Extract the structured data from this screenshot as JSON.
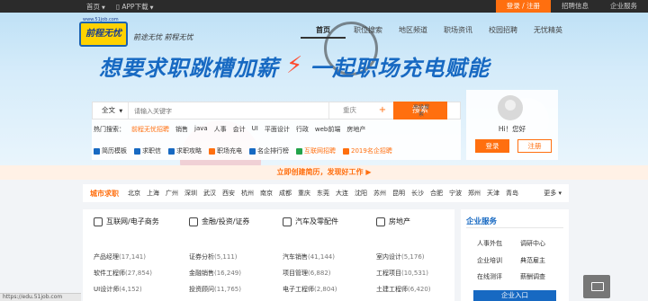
{
  "topbar": {
    "home": "首页",
    "app": "APP下载",
    "login_register": "登录 / 注册",
    "recruit_info": "招聘信息",
    "enterprise_service": "企业服务"
  },
  "logo": {
    "text": "前程无忧",
    "url": "www.51job.com"
  },
  "slogan": "前途无忧 前程无忧",
  "nav": [
    "首页",
    "职位搜索",
    "地区频道",
    "职场资讯",
    "校园招聘",
    "无忧精英"
  ],
  "banner": {
    "left": "想要求职跳槽加薪",
    "bolt": "⚡",
    "right": "一起职场充电赋能"
  },
  "search": {
    "type": "全文",
    "placeholder": "请输入关键字",
    "city": "重庆",
    "plus": "+",
    "button": "搜索",
    "advanced": "高级搜索"
  },
  "hot": {
    "label": "热门搜索：",
    "items": [
      "前程无忧招聘",
      "销售",
      "java",
      "人事",
      "会计",
      "UI",
      "平面设计",
      "行政",
      "web前端",
      "房地产"
    ]
  },
  "tools": [
    "简历模板",
    "求职信",
    "求职攻略",
    "职场充电",
    "名企排行榜",
    "互联网招聘",
    "2019名企招聘"
  ],
  "login": {
    "greeting": "Hi！您好",
    "login": "登录",
    "register": "注册"
  },
  "resume_strip": "立即创建简历，发现好工作 ▶",
  "city_row": {
    "title": "城市求职",
    "cities": [
      "北京",
      "上海",
      "广州",
      "深圳",
      "武汉",
      "西安",
      "杭州",
      "南京",
      "成都",
      "重庆",
      "东莞",
      "大连",
      "沈阳",
      "苏州",
      "昆明",
      "长沙",
      "合肥",
      "宁波",
      "郑州",
      "天津",
      "青岛"
    ],
    "more": "更多 ▾"
  },
  "categories": [
    {
      "title": "互联网/电子商务",
      "jobs": [
        {
          "name": "产品经理",
          "count": "(17,141)"
        },
        {
          "name": "软件工程师",
          "count": "(27,854)"
        },
        {
          "name": "UI设计师",
          "count": "(4,152)"
        }
      ]
    },
    {
      "title": "金融/投资/证券",
      "jobs": [
        {
          "name": "证券分析",
          "count": "(5,111)"
        },
        {
          "name": "金融销售",
          "count": "(16,249)"
        },
        {
          "name": "投资顾问",
          "count": "(11,765)"
        }
      ]
    },
    {
      "title": "汽车及零配件",
      "jobs": [
        {
          "name": "汽车销售",
          "count": "(41,144)"
        },
        {
          "name": "项目管理",
          "count": "(6,882)"
        },
        {
          "name": "电子工程师",
          "count": "(2,804)"
        }
      ]
    },
    {
      "title": "房地产",
      "jobs": [
        {
          "name": "室内设计",
          "count": "(5,176)"
        },
        {
          "name": "工程项目",
          "count": "(10,531)"
        },
        {
          "name": "土建工程师",
          "count": "(6,420)"
        }
      ]
    }
  ],
  "enterprise": {
    "title": "企业服务",
    "items": [
      "人事外包",
      "调研中心",
      "企业培训",
      "典范雇主",
      "在线测评",
      "薪酬调查"
    ],
    "button": "企业入口"
  },
  "statusbar": "https://edu.51job.com"
}
